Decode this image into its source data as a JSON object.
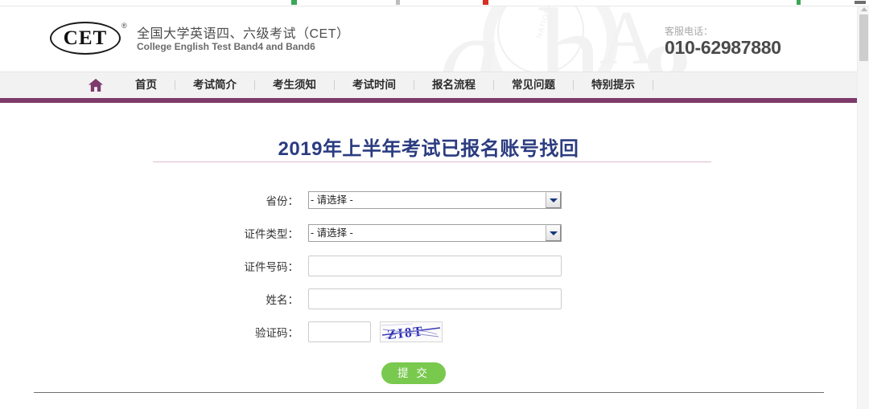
{
  "browser": {
    "chrome_dots": [
      "#3aa757",
      "#6e6e6e",
      "#d93025",
      "#3aa757",
      "#5f6368"
    ]
  },
  "header": {
    "logo_text": "CET",
    "logo_registered_mark": "®",
    "site_title": "全国大学英语四、六级考试（CET）",
    "site_subtitle": "College English Test Band4 and Band6",
    "hotline_label": "客服电话：",
    "hotline_number": "010-62987880",
    "watermark_letters": [
      "g",
      "h",
      "A",
      "g"
    ],
    "watermark_seal_text": "NATIONAL EXAM"
  },
  "nav": {
    "home_icon": "home-icon",
    "items": [
      {
        "label": "首页"
      },
      {
        "label": "考试简介"
      },
      {
        "label": "考生须知"
      },
      {
        "label": "考试时间"
      },
      {
        "label": "报名流程"
      },
      {
        "label": "常见问题"
      },
      {
        "label": "特别提示"
      }
    ],
    "accent_color": "#7d3a6b"
  },
  "main": {
    "page_title": "2019年上半年考试已报名账号找回",
    "title_color": "#2b3c80",
    "rule_color": "#e0b9d2",
    "form": {
      "province": {
        "label": "省份：",
        "selected": "- 请选择 -",
        "options": [
          "- 请选择 -"
        ]
      },
      "id_type": {
        "label": "证件类型：",
        "selected": "- 请选择 -",
        "options": [
          "- 请选择 -"
        ]
      },
      "id_number": {
        "label": "证件号码：",
        "value": "",
        "placeholder": ""
      },
      "name": {
        "label": "姓名：",
        "value": "",
        "placeholder": ""
      },
      "captcha": {
        "label": "验证码：",
        "value": "",
        "placeholder": "",
        "image_text": "ZI8T"
      },
      "submit_label": "提 交",
      "submit_color": "#79c94f"
    }
  }
}
